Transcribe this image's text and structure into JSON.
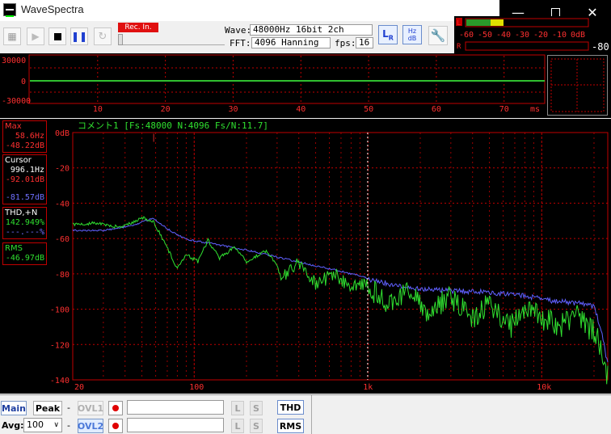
{
  "window": {
    "title": "WaveSpectra"
  },
  "toolbar": {
    "rec_label": "Rec. In.",
    "wave_label": "Wave:",
    "wave_value": "48000Hz 16bit 2ch",
    "fft_label": "FFT:",
    "fft_value": "4096 Hanning",
    "fps_label": "fps:",
    "fps_value": "16"
  },
  "level_meter": {
    "l_label": "L",
    "r_label": "R",
    "scale": [
      "-60",
      "-50",
      "-40",
      "-30",
      "-20",
      "-10",
      "0dB"
    ],
    "peak_value": "-80"
  },
  "wave": {
    "y_labels": [
      "30000",
      "0",
      "-30000"
    ],
    "x_ticks": [
      "10",
      "20",
      "30",
      "40",
      "50",
      "60",
      "70"
    ],
    "x_unit": "ms"
  },
  "spectrum": {
    "header": "コメント1  [Fs:48000 N:4096 Fs/N:11.7]",
    "max_label": "Max",
    "max_hz": "58.6Hz",
    "max_db": "-48.22dB",
    "cursor_label": "Cursor",
    "cursor_hz": "996.1Hz",
    "cursor_db1": "-92.01dB",
    "cursor_db2": "-81.57dB",
    "thd_label": "THD,+N",
    "thd_value": "142.949%",
    "thd_value2": "---.---%",
    "rms_label": "RMS",
    "rms_value": "-46.97dB"
  },
  "chart_data": {
    "type": "line",
    "x_scale": "log",
    "xlim": [
      20,
      24000
    ],
    "ylim": [
      -140,
      0
    ],
    "y_ticks": [
      "0dB",
      "-20",
      "-40",
      "-60",
      "-80",
      "-100",
      "-120",
      "-140"
    ],
    "x_ticks": [
      "20",
      "100",
      "1k",
      "10k"
    ],
    "series": [
      {
        "color": "#6060ff",
        "x": [
          20,
          30,
          45,
          58,
          70,
          90,
          120,
          200,
          300,
          500,
          700,
          1000,
          1500,
          2000,
          3000,
          5000,
          8000,
          12000,
          16000,
          20000,
          22000,
          24000
        ],
        "y": [
          -55,
          -55,
          -52,
          -48,
          -54,
          -60,
          -62,
          -66,
          -70,
          -75,
          -78,
          -82,
          -85,
          -87,
          -88,
          -89,
          -91,
          -94,
          -95,
          -97,
          -110,
          -130
        ]
      },
      {
        "color": "#30e030",
        "x": [
          20,
          28,
          38,
          50,
          58,
          68,
          80,
          90,
          105,
          120,
          140,
          170,
          200,
          260,
          320,
          400,
          500,
          650,
          800,
          1000,
          1300,
          1700,
          2200,
          3000,
          4000,
          5000,
          6500,
          8000,
          10000,
          13000,
          16000,
          19000,
          21000,
          23000,
          24000
        ],
        "y": [
          -51,
          -50,
          -53,
          -47,
          -49,
          -62,
          -76,
          -68,
          -72,
          -60,
          -70,
          -64,
          -72,
          -66,
          -78,
          -70,
          -82,
          -76,
          -84,
          -80,
          -90,
          -82,
          -94,
          -86,
          -100,
          -88,
          -104,
          -92,
          -98,
          -102,
          -96,
          -104,
          -108,
          -125,
          -132
        ]
      }
    ],
    "cursor_x": 996.1
  },
  "bottom": {
    "main_btn": "Main",
    "peak_btn": "Peak",
    "ovl1_btn": "OVL1",
    "ovl2_btn": "OVL2",
    "avg_label": "Avg:",
    "avg_value": "100",
    "dash": "-",
    "l_btn": "L",
    "s_btn": "S",
    "thd_btn": "THD",
    "rms_btn": "RMS"
  }
}
